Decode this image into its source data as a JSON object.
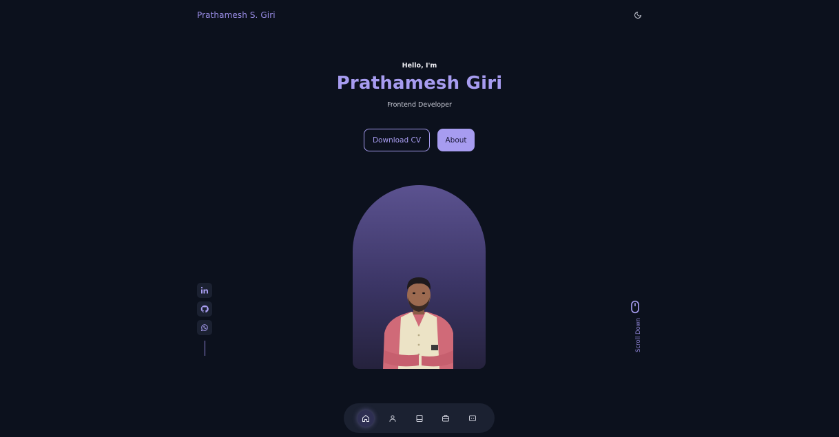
{
  "header": {
    "brand": "Prathamesh S. Giri",
    "theme_icon": "moon-icon"
  },
  "hero": {
    "greeting": "Hello, I'm",
    "name": "Prathamesh Giri",
    "role": "Frontend Developer",
    "download_cv_label": "Download CV",
    "about_label": "About"
  },
  "socials": [
    {
      "icon": "linkedin-icon"
    },
    {
      "icon": "github-icon"
    },
    {
      "icon": "whatsapp-icon"
    }
  ],
  "scroll": {
    "label": "Scroll Down",
    "icon": "mouse-icon"
  },
  "bottom_nav": {
    "items": [
      {
        "icon": "home-icon",
        "active": true
      },
      {
        "icon": "user-icon",
        "active": false
      },
      {
        "icon": "book-icon",
        "active": false
      },
      {
        "icon": "briefcase-icon",
        "active": false
      },
      {
        "icon": "message-icon",
        "active": false
      }
    ]
  },
  "colors": {
    "background": "#0c111d",
    "accent": "#a79cf0",
    "surface": "#1b2131"
  }
}
